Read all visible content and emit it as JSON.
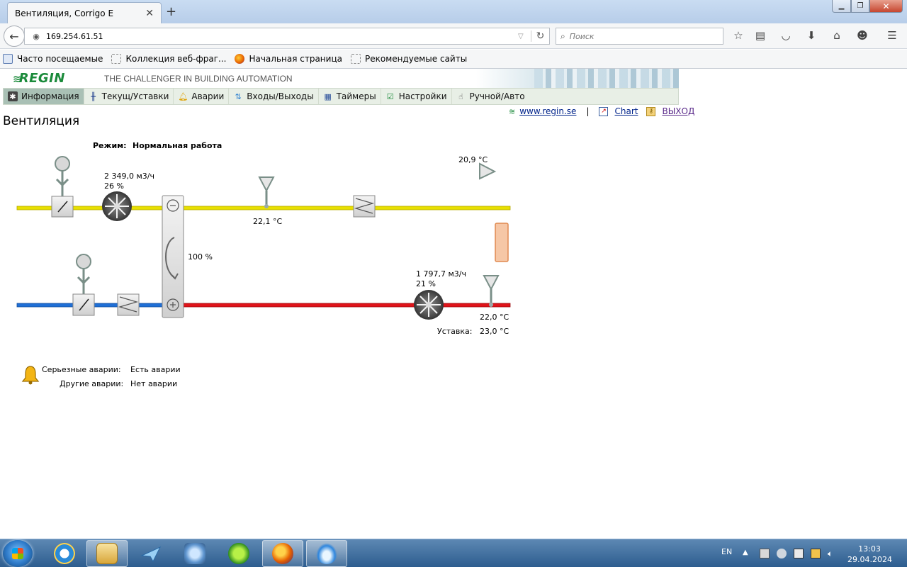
{
  "browser": {
    "tab_title": "Вентиляция, Corrigo E",
    "url": "169.254.61.51",
    "search_placeholder": "Поиск",
    "bookmarks": [
      {
        "label": "Часто посещаемые",
        "icon": "page-icon"
      },
      {
        "label": "Коллекция веб-фраг...",
        "icon": "blank-page-icon"
      },
      {
        "label": "Начальная страница",
        "icon": "firefox-icon"
      },
      {
        "label": "Рекомендуемые сайты",
        "icon": "blank-page-icon"
      }
    ]
  },
  "header": {
    "logo": "REGIN",
    "tagline": "THE CHALLENGER IN BUILDING AUTOMATION"
  },
  "menu": [
    {
      "label": "Информация",
      "icon": "fan-icon",
      "active": true
    },
    {
      "label": "Текущ/Уставки",
      "icon": "thermometer-icon",
      "active": false
    },
    {
      "label": "Аварии",
      "icon": "bell-icon",
      "active": false
    },
    {
      "label": "Входы/Выходы",
      "icon": "arrows-icon",
      "active": false
    },
    {
      "label": "Таймеры",
      "icon": "calendar-icon",
      "active": false
    },
    {
      "label": "Настройки",
      "icon": "checklist-icon",
      "active": false
    },
    {
      "label": "Ручной/Авто",
      "icon": "hand-icon",
      "active": false
    }
  ],
  "links": {
    "site": "www.regin.se",
    "separator": "|",
    "chart": "Chart",
    "logout": "ВЫХОД"
  },
  "page": {
    "title": "Вентиляция",
    "mode_label": "Режим:",
    "mode_value": "Нормальная работа"
  },
  "diagram": {
    "supply_fan_flow": "2 349,0 м3/ч",
    "supply_fan_pct": "26 %",
    "supply_temp": "22,1 °C",
    "room_temp": "20,9 °C",
    "heat_exchanger_pct": "100 %",
    "exhaust_fan_flow": "1 797,7 м3/ч",
    "exhaust_fan_pct": "21 %",
    "exhaust_temp": "22,0 °C",
    "setpoint_label": "Уставка:",
    "setpoint_value": "23,0 °C",
    "colors": {
      "supply_duct": "#e8e000",
      "outdoor_duct": "#1f6fd6",
      "exhaust_duct": "#e0141a"
    }
  },
  "alarms": {
    "serious_label": "Серьезные аварии:",
    "serious_value": "Есть аварии",
    "other_label": "Другие аварии:",
    "other_value": "Нет аварии"
  },
  "taskbar": {
    "apps": [
      "internet-explorer-icon",
      "file-explorer-icon",
      "paper-plane-icon",
      "network-icon",
      "green-app-icon",
      "firefox-icon",
      "blue-app-icon"
    ],
    "language": "EN",
    "time": "13:03",
    "date": "29.04.2024"
  }
}
